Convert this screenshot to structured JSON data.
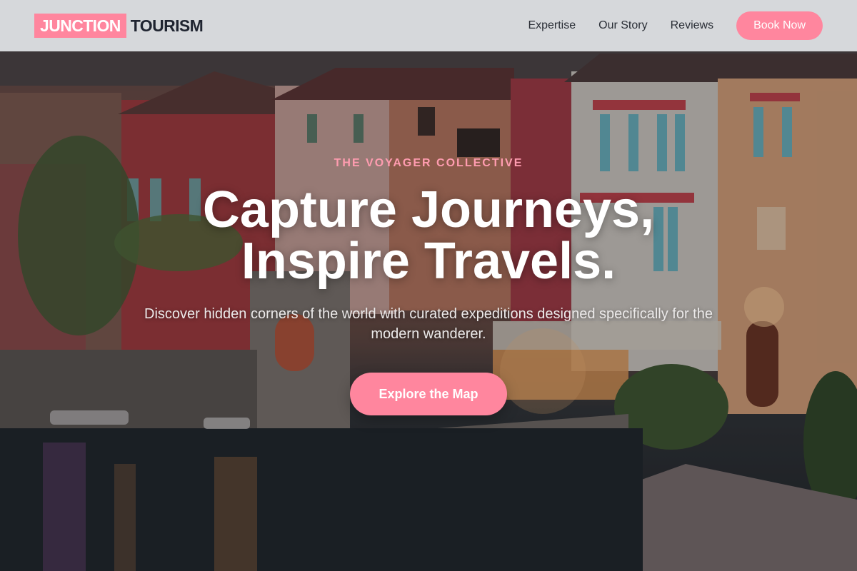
{
  "brand": {
    "highlight": "JUNCTION",
    "rest": "TOURISM"
  },
  "nav": {
    "items": [
      {
        "label": "Expertise"
      },
      {
        "label": "Our Story"
      },
      {
        "label": "Reviews"
      }
    ],
    "cta_label": "Book Now"
  },
  "hero": {
    "eyebrow": "THE VOYAGER COLLECTIVE",
    "headline_line1": "Capture Journeys,",
    "headline_line2": "Inspire Travels.",
    "subtext": "Discover hidden corners of the world with curated expeditions designed specifically for the modern wanderer.",
    "cta_label": "Explore the Map",
    "background_icon": "lakeside-town-photo"
  },
  "colors": {
    "accent": "#ff869e",
    "eyebrow": "#ff9cb0",
    "header_bg": "#e2e4e7",
    "text_dark": "#1f2430"
  }
}
